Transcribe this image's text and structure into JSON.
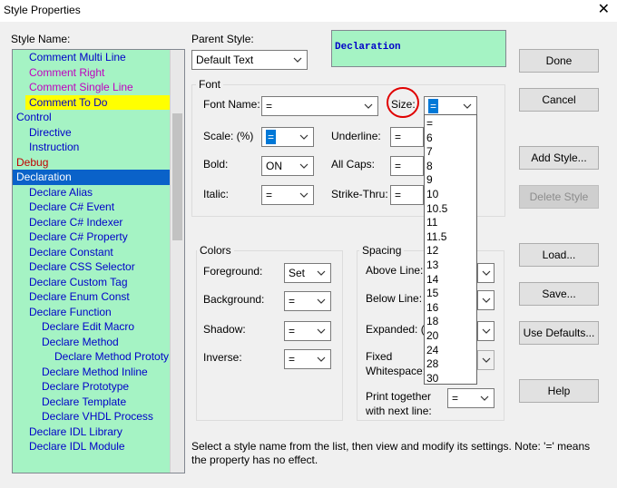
{
  "window": {
    "title": "Style Properties",
    "close_glyph": "✕"
  },
  "labels": {
    "style_name": "Style Name:",
    "parent_style": "Parent Style:",
    "font_group": "Font",
    "font_name": "Font Name:",
    "size": "Size:",
    "scale": "Scale: (%)",
    "underline": "Underline:",
    "bold": "Bold:",
    "all_caps": "All Caps:",
    "italic": "Italic:",
    "strike_thru": "Strike-Thru:",
    "colors_group": "Colors",
    "foreground": "Foreground:",
    "background": "Background:",
    "shadow": "Shadow:",
    "inverse": "Inverse:",
    "spacing_group": "Spacing",
    "above_line": "Above Line:",
    "below_line": "Below Line:",
    "expanded": "Expanded: (",
    "fixed_whitespace_1": "Fixed",
    "fixed_whitespace_2": "Whitespace:",
    "print_together_1": "Print together",
    "print_together_2": "with next line:"
  },
  "preview_text": "Declaration",
  "parent_style_value": "Default Text",
  "font": {
    "font_name": "=",
    "size": "=",
    "scale": "=",
    "underline": "=",
    "bold": "ON",
    "all_caps": "=",
    "italic": "=",
    "strike_thru": "="
  },
  "colors": {
    "foreground": "Set",
    "background": "=",
    "shadow": "=",
    "inverse": "="
  },
  "spacing": {
    "print_together": "="
  },
  "size_options": [
    "=",
    "6",
    "7",
    "8",
    "9",
    "10",
    "10.5",
    "11",
    "11.5",
    "12",
    "13",
    "14",
    "15",
    "16",
    "18",
    "20",
    "24",
    "28",
    "30"
  ],
  "style_list": [
    {
      "label": "Comment Multi Line",
      "indent": 1,
      "state": "normal"
    },
    {
      "label": "Comment Right",
      "indent": 1,
      "state": "pink"
    },
    {
      "label": "Comment Single Line",
      "indent": 1,
      "state": "pink"
    },
    {
      "label": "Comment To Do",
      "indent": 1,
      "state": "highlight"
    },
    {
      "label": "Control",
      "indent": 0,
      "state": "normal"
    },
    {
      "label": "Directive",
      "indent": 1,
      "state": "normal"
    },
    {
      "label": "Instruction",
      "indent": 1,
      "state": "normal"
    },
    {
      "label": "Debug",
      "indent": 0,
      "state": "red"
    },
    {
      "label": "Declaration",
      "indent": 0,
      "state": "selected"
    },
    {
      "label": "Declare Alias",
      "indent": 1,
      "state": "normal"
    },
    {
      "label": "Declare C# Event",
      "indent": 1,
      "state": "normal"
    },
    {
      "label": "Declare C# Indexer",
      "indent": 1,
      "state": "normal"
    },
    {
      "label": "Declare C# Property",
      "indent": 1,
      "state": "normal"
    },
    {
      "label": "Declare Constant",
      "indent": 1,
      "state": "normal"
    },
    {
      "label": "Declare CSS Selector",
      "indent": 1,
      "state": "normal"
    },
    {
      "label": "Declare Custom Tag",
      "indent": 1,
      "state": "normal"
    },
    {
      "label": "Declare Enum Const",
      "indent": 1,
      "state": "normal"
    },
    {
      "label": "Declare Function",
      "indent": 1,
      "state": "normal"
    },
    {
      "label": "Declare Edit Macro",
      "indent": 2,
      "state": "normal"
    },
    {
      "label": "Declare Method",
      "indent": 2,
      "state": "normal"
    },
    {
      "label": "Declare Method Prototy",
      "indent": 3,
      "state": "normal"
    },
    {
      "label": "Declare Method Inline",
      "indent": 2,
      "state": "normal"
    },
    {
      "label": "Declare Prototype",
      "indent": 2,
      "state": "normal"
    },
    {
      "label": "Declare Template",
      "indent": 2,
      "state": "normal"
    },
    {
      "label": "Declare VHDL Process",
      "indent": 2,
      "state": "normal"
    },
    {
      "label": "Declare IDL Library",
      "indent": 1,
      "state": "normal"
    },
    {
      "label": "Declare IDL Module",
      "indent": 1,
      "state": "normal"
    }
  ],
  "buttons": {
    "done": "Done",
    "cancel": "Cancel",
    "add_style": "Add Style...",
    "delete_style": "Delete Style",
    "load": "Load...",
    "save": "Save...",
    "use_defaults": "Use Defaults...",
    "help": "Help"
  },
  "help_text": "Select a style name from the list, then view and modify its settings. Note: '=' means the property has no effect.",
  "colors_meta": {
    "list_bg": "#a5f3c4",
    "selection": "#0a62c9",
    "highlight": "#ffff00",
    "annotation_circle": "#e00000"
  },
  "icons": [
    "close-icon",
    "chevron-down-icon"
  ]
}
